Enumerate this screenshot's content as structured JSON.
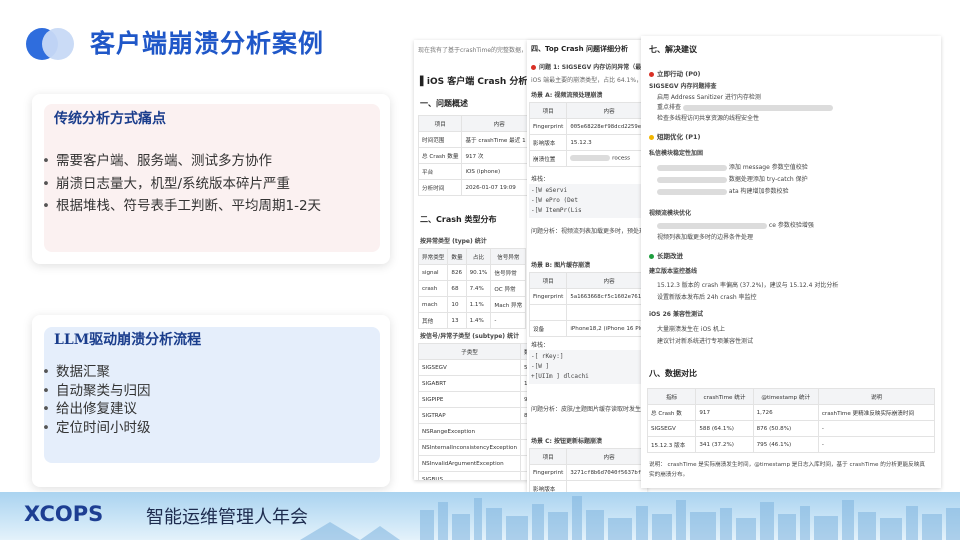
{
  "slide": {
    "title": "客户端崩溃分析案例"
  },
  "card_traditional": {
    "heading": "传统分析方式痛点",
    "bullets": [
      "需要客户端、服务端、测试多方协作",
      "崩溃日志量大，机型/系统版本碎片严重",
      "根据堆栈、符号表手工判断、平均周期1-2天"
    ]
  },
  "card_llm": {
    "heading": "LLM驱动崩溃分析流程",
    "bullets": [
      "数据汇聚",
      "自动聚类与归因",
      "给出修复建议",
      "定位时间小时级"
    ]
  },
  "doc1": {
    "intro": "现在我有了基于crashTime的完整数据，让我生",
    "title": "iOS 客户端 Crash 分析报告",
    "section1": "一、问题概述",
    "overview_header": [
      "项目",
      "内容"
    ],
    "overview_rows": [
      [
        "时间范围",
        "基于 crashTime 最近 1 小"
      ],
      [
        "总 Crash 数量",
        "917 次"
      ],
      [
        "平台",
        "iOS (iphone)"
      ],
      [
        "分析时间",
        "2026-01-07 19:09"
      ]
    ],
    "section2": "二、Crash 类型分布",
    "type_label": "按异常类型 (type) 统计",
    "type_header": [
      "异常类型",
      "数量",
      "占比",
      "信号异常"
    ],
    "type_rows": [
      [
        "signal",
        "826",
        "90.1%",
        "信号异常"
      ],
      [
        "crash",
        "68",
        "7.4%",
        "OC 异常"
      ],
      [
        "mach",
        "10",
        "1.1%",
        "Mach 异常"
      ],
      [
        "其他",
        "13",
        "1.4%",
        "-"
      ]
    ],
    "subtype_label": "按信号/异常子类型 (subtype) 统计",
    "subtype_header": [
      "子类型",
      "数"
    ],
    "subtype_rows": [
      "SIGSEGV",
      "SIGABRT",
      "SIGPIPE",
      "SIGTRAP",
      "NSRangeException",
      "NSInternalInconsistencyException",
      "NSInvalidArgumentException",
      "SIGBUS"
    ],
    "subtype_counts": [
      "5",
      "1",
      "9",
      "8",
      "",
      "",
      "",
      ""
    ]
  },
  "doc2": {
    "section4": "四、Top Crash 问题详细分析",
    "issue1": "问题 1: SIGSEGV 内存访问异常（最",
    "issue1_desc": "iOS 端最主要的崩溃类型，占比 64.1%，主",
    "scene_a": "场景 A: 视频流预处理崩溃",
    "row_header": [
      "项目",
      "内容"
    ],
    "fingerprint_label": "Fingerprint",
    "fingerprint_a": "005e68228ef98dcd2259e6e",
    "impact_label": "影响版本",
    "impact_a": "15.12.3",
    "stack_label": "崩溃位置",
    "stack_a": "rocess",
    "stack_title": "堆栈：",
    "stack_lines": [
      "-[W                    eServi",
      "-[W               ePro  (Det",
      "-[W               ItemPr(Lis"
    ],
    "analysis_a": "问题分析：视频流列表加载更多时，预处理视频",
    "scene_b": "场景 B: 图片缓存崩溃",
    "fingerprint_b": "5a1663668cf5c1602e7613f",
    "device_label": "设备",
    "device_b": "iPhone18,2 (iPhone 16 Plus",
    "stack_b_title": "堆栈：",
    "stack_b_lines": [
      "-[           rKey:]",
      "-[W           ]",
      "+[UIIm    ]   dlcachi"
    ],
    "analysis_b": "问题分析：皮肤/主题图片缓存读取时发生内存访",
    "scene_c": "场景 C: 按钮更新标题崩溃",
    "fingerprint_c": "3271cf8b6d7040f5637bf74",
    "impact_c_label": "影响版本"
  },
  "doc3": {
    "section7": "七、解决建议",
    "p0": "立即行动 (P0)",
    "p0_sub": "SIGSEGV 内存问题排查",
    "p0_items": [
      "启用 Address Sanitizer 进行内存检测",
      "重点排查",
      "检查多线程访问共享资源的线程安全性"
    ],
    "p1": "短期优化 (P1)",
    "p1_sub1": "私信模块稳定性加固",
    "p1_items1": [
      "添加 message 参数空值校验",
      "数据处理添加 try-catch 保护",
      "ata 构建增加参数校验"
    ],
    "p1_sub2": "视频流模块优化",
    "p1_items2": [
      "ce 参数校验增强",
      "视频列表加载更多时的边界条件处理"
    ],
    "p2": "长期改进",
    "p2_sub1": "建立版本监控基线",
    "p2_items1": [
      "15.12.3 版本的 crash 率偏高 (37.2%)，建议与 15.12.4 对比分析",
      "设置新版本发布后 24h crash 率监控"
    ],
    "p2_sub2": "iOS 26 兼容性测试",
    "p2_items2": [
      "大量崩溃发生在 iOS       机上",
      "建议针对新系统进行专项兼容性测试"
    ],
    "section8": "八、数据对比",
    "compare_header": [
      "指标",
      "crashTime 统计",
      "@timestamp 统计",
      "说明"
    ],
    "compare_rows": [
      [
        "总 Crash 数",
        "917",
        "1,726",
        "crashTime 更精准反映实际崩溃时间"
      ],
      [
        "SIGSEGV",
        "588 (64.1%)",
        "876 (50.8%)",
        "-"
      ],
      [
        "15.12.3 版本",
        "341 (37.2%)",
        "795 (46.1%)",
        "-"
      ]
    ],
    "note": "说明： crashTime 是实际崩溃发生时间，@timestamp 是日志入库时间，基于 crashTime 的分析更能反映真",
    "note2": "实的崩溃分布。"
  },
  "footer": {
    "brand": "XCOPS",
    "event": "智能运维管理人年会"
  }
}
